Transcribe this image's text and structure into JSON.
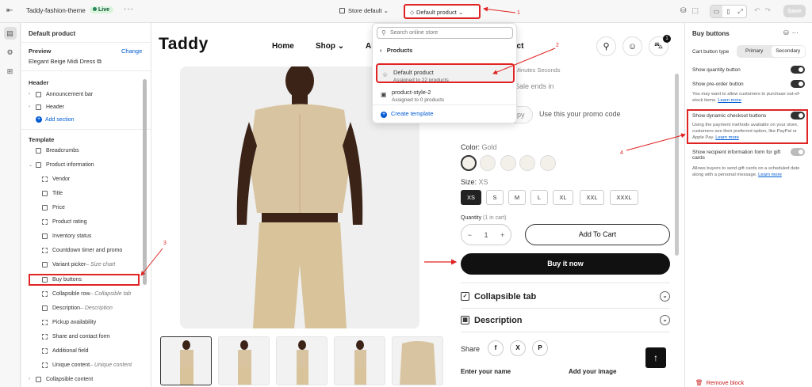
{
  "topbar": {
    "theme_name": "Taddy-fashion-theme",
    "live_badge": "Live",
    "more": "···",
    "store_selector": "Store default",
    "template_selector": "Default product",
    "save_label": "Save"
  },
  "left_panel": {
    "title": "Default product",
    "preview_label": "Preview",
    "change_label": "Change",
    "preview_product": "Elegant Beige Midi Dress",
    "header_section": "Header",
    "header_items": [
      {
        "label": "Announcement bar"
      },
      {
        "label": "Header"
      }
    ],
    "add_section": "Add section",
    "template_section": "Template",
    "template_items": [
      {
        "label": "Breadcrumbs",
        "sub": ""
      },
      {
        "label": "Product information",
        "sub": ""
      },
      {
        "label": "Vendor",
        "sub": ""
      },
      {
        "label": "Title",
        "sub": ""
      },
      {
        "label": "Price",
        "sub": ""
      },
      {
        "label": "Product rating",
        "sub": ""
      },
      {
        "label": "Inventory status",
        "sub": ""
      },
      {
        "label": "Countdown timer and promo",
        "sub": ""
      },
      {
        "label": "Variant picker",
        "sub": " – Size chart"
      },
      {
        "label": "Buy buttons",
        "sub": ""
      },
      {
        "label": "Collapsible row",
        "sub": " – Collapsible tab"
      },
      {
        "label": "Description",
        "sub": " – Description"
      },
      {
        "label": "Pickup availability",
        "sub": ""
      },
      {
        "label": "Share and contact form",
        "sub": ""
      },
      {
        "label": "Additional field",
        "sub": ""
      },
      {
        "label": "Unique content",
        "sub": " – Unique content"
      },
      {
        "label": "Collapsible content",
        "sub": ""
      }
    ]
  },
  "dropdown": {
    "search_placeholder": "Search online store",
    "header": "Products",
    "options": [
      {
        "name": "Default product",
        "assigned": "Assigned to 22 products"
      },
      {
        "name": "product-style-2",
        "assigned": "Assigned to 0 products"
      }
    ],
    "create": "Create template"
  },
  "preview": {
    "logo": "Taddy",
    "nav": [
      "Home",
      "Shop",
      "Al",
      "act"
    ],
    "cart_count": "1",
    "timer_labels": "Minutes    Seconds",
    "sale_text": "Sale ends in",
    "promo_code": "py",
    "promo_text": "Use this your promo code",
    "color_label": "Color:",
    "color_value": "Gold",
    "size_label": "Size:",
    "size_value": "XS",
    "sizes": [
      "XS",
      "S",
      "M",
      "L",
      "XL",
      "XXL",
      "XXXL"
    ],
    "quantity_label": "Quantity",
    "in_cart": "(1 in cart)",
    "qty_minus": "−",
    "qty_value": "1",
    "qty_plus": "+",
    "add_to_cart": "Add To Cart",
    "buy_now": "Buy it now",
    "accordions": [
      "Collapsible tab",
      "Description"
    ],
    "share_label": "Share",
    "social": [
      "f",
      "X",
      "P"
    ],
    "field_name": "Enter your name",
    "field_image": "Add your image"
  },
  "right_panel": {
    "title": "Buy buttons",
    "cart_button_type_label": "Cart button type",
    "segments": [
      "Primary",
      "Secondary"
    ],
    "show_quantity": "Show quantity button",
    "show_preorder": "Show pre-order button",
    "preorder_help": "You may want to allow customers to purchase out-of-stock items.",
    "learn_more": "Learn more",
    "show_dynamic": "Show dynamic checkout buttons",
    "dynamic_help": "Using the payment methods available on your store, customers see their preferred option, like PayPal or Apple Pay.",
    "show_recipient": "Show recipient information form for gift cards",
    "recipient_help": "Allows buyers to send gift cards on a scheduled date along with a personal message.",
    "remove_block": "Remove block"
  },
  "annotations": [
    "1",
    "2",
    "3",
    "4"
  ],
  "colors": {
    "annotation": "#e02424",
    "link": "#005bd3",
    "live": "#29845a"
  }
}
